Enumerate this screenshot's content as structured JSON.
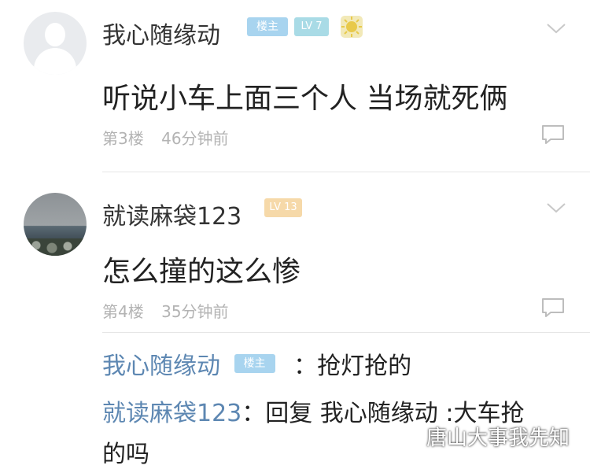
{
  "posts": [
    {
      "username": "我心随缘动",
      "badge_owner": "楼主",
      "badge_level": "LV 7",
      "content": "听说小车上面三个人 当场就死俩",
      "floor": "第3楼",
      "time": "46分钟前"
    },
    {
      "username": "就读麻袋123",
      "badge_level": "LV 13",
      "content": "怎么撞的这么惨",
      "floor": "第4楼",
      "time": "35分钟前"
    }
  ],
  "replies": [
    {
      "author": "我心随缘动",
      "badge": "楼主",
      "text": "：抢灯抢的"
    },
    {
      "author": "就读麻袋123",
      "text_line1": "：回复 我心随缘动 :大车抢",
      "text_line2": "的吗"
    }
  ],
  "watermark": "唐山大事我先知",
  "colors": {
    "link_blue": "#5d87b2",
    "badge_owner": "#a8d4ef",
    "meta_gray": "#b3b3b3"
  }
}
